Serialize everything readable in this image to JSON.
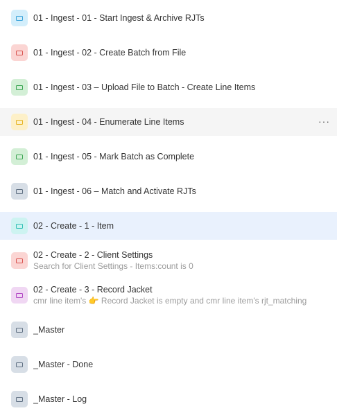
{
  "items": [
    {
      "title": "01 - Ingest - 01 - Start Ingest & Archive RJTs",
      "subtitle": "",
      "icon": "table-icon",
      "icon_bg": "#d3eefb",
      "icon_fg": "#3aa3d9",
      "state": "normal"
    },
    {
      "title": "01 - Ingest - 02 - Create Batch from File",
      "subtitle": "",
      "icon": "table-icon",
      "icon_bg": "#fbd5d3",
      "icon_fg": "#d9534f",
      "state": "normal"
    },
    {
      "title": "01 - Ingest - 03 – Upload File to Batch - Create Line Items",
      "subtitle": "",
      "icon": "table-icon",
      "icon_bg": "#d3efd6",
      "icon_fg": "#3aa552",
      "state": "normal"
    },
    {
      "title": "01 - Ingest - 04 - Enumerate Line Items",
      "subtitle": "",
      "icon": "table-icon",
      "icon_bg": "#fdf0c8",
      "icon_fg": "#e6b422",
      "state": "hover",
      "more": "···"
    },
    {
      "title": "01 - Ingest - 05 - Mark Batch as Complete",
      "subtitle": "",
      "icon": "table-icon",
      "icon_bg": "#d3efd6",
      "icon_fg": "#3aa552",
      "state": "normal"
    },
    {
      "title": "01 - Ingest - 06 – Match and Activate RJTs",
      "subtitle": "",
      "icon": "table-icon",
      "icon_bg": "#d7dee6",
      "icon_fg": "#5f6f82",
      "state": "normal"
    },
    {
      "title": "02 - Create - 1 - Item",
      "subtitle": "",
      "icon": "table-icon",
      "icon_bg": "#cdf3f1",
      "icon_fg": "#2fbfb5",
      "state": "selected"
    },
    {
      "title": "02 - Create - 2 - Client Settings",
      "subtitle": "Search for Client Settings - Items:count is 0",
      "icon": "table-icon",
      "icon_bg": "#fbd5d3",
      "icon_fg": "#d9534f",
      "state": "normal"
    },
    {
      "title": "02 - Create - 3 - Record Jacket",
      "subtitle": "cmr line item's 👉 Record Jacket is empty and cmr line item's rjt_matching",
      "icon": "table-icon",
      "icon_bg": "#f0d7f3",
      "icon_fg": "#b145c4",
      "state": "normal"
    },
    {
      "title": "_Master",
      "subtitle": "",
      "icon": "table-icon",
      "icon_bg": "#d7dee6",
      "icon_fg": "#5f6f82",
      "state": "normal"
    },
    {
      "title": "_Master - Done",
      "subtitle": "",
      "icon": "table-icon",
      "icon_bg": "#d7dee6",
      "icon_fg": "#5f6f82",
      "state": "normal"
    },
    {
      "title": "_Master - Log",
      "subtitle": "",
      "icon": "table-icon",
      "icon_bg": "#d7dee6",
      "icon_fg": "#5f6f82",
      "state": "normal"
    }
  ]
}
